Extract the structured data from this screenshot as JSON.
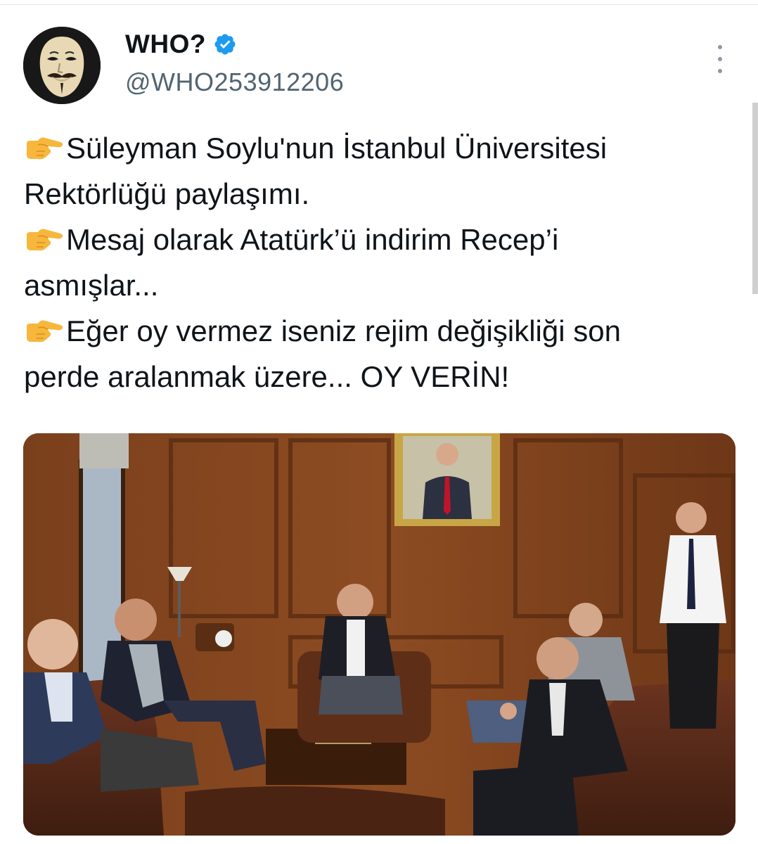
{
  "author": {
    "display_name": "WHO?",
    "handle": "@WHO253912206",
    "verified": true,
    "avatar_icon": "guy-fawkes-mask-avatar"
  },
  "tweet": {
    "lines": [
      {
        "emoji": "backhand-index-pointing-right",
        "text": "Süleyman Soylu'nun İstanbul Üniversitesi"
      },
      {
        "emoji": "",
        "text": "Rektörlüğü paylaşımı."
      },
      {
        "emoji": "backhand-index-pointing-right",
        "text": "Mesaj olarak Atatürk’ü indirim Recep’i"
      },
      {
        "emoji": "",
        "text": "asmışlar..."
      },
      {
        "emoji": "backhand-index-pointing-right",
        "text": "Eğer oy vermez iseniz rejim değişikliği son"
      },
      {
        "emoji": "",
        "text": "perde aralanmak üzere... OY VERİN!"
      }
    ]
  },
  "media": {
    "type": "photo",
    "description_icon": "office-meeting-photo"
  },
  "colors": {
    "verified_badge": "#1d9bf0",
    "handle_text": "#536471",
    "main_text": "#0f1419",
    "emoji_hand": "#f6b73c"
  }
}
